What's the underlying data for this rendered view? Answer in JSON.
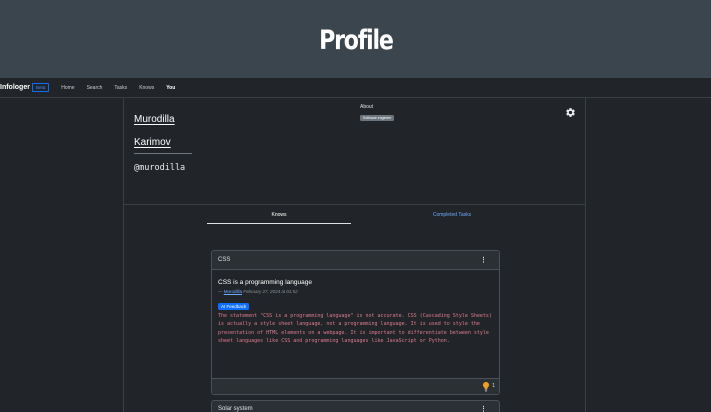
{
  "hero": {
    "title": "Profile"
  },
  "navbar": {
    "brand": "Infologer",
    "beta": "Beta",
    "links": [
      "Home",
      "Search",
      "Tasks",
      "Knows",
      "You"
    ]
  },
  "profile": {
    "first_name": "Murodilla",
    "last_name": "Karimov",
    "handle": "@murodilla",
    "about_label": "About",
    "about_badge": "Software engineer"
  },
  "tabs": {
    "knows": "Knows",
    "completed": "Completed Tasks"
  },
  "cards": [
    {
      "header": "CSS",
      "title": "CSS is a programming language",
      "meta_prefix": "— ",
      "author": "Murodilla",
      "date": "February 27, 2024 at 01:52",
      "ai_badge": "AI Feedback",
      "feedback": "The statement \"CSS is a programming language\" is not accurate. CSS (Cascading Style Sheets) is actually a style sheet language, not a programming language. It is used to style the presentation of HTML elements on a webpage. It is important to differentiate between style sheet languages like CSS and programming languages like JavaScript or Python.",
      "likes": "1"
    },
    {
      "header": "Solar system"
    }
  ],
  "colors": {
    "accent": "#0d6efd",
    "link": "#6ea8fe",
    "feedback_text": "#e07a8d",
    "hero_bg": "#3a454d"
  }
}
